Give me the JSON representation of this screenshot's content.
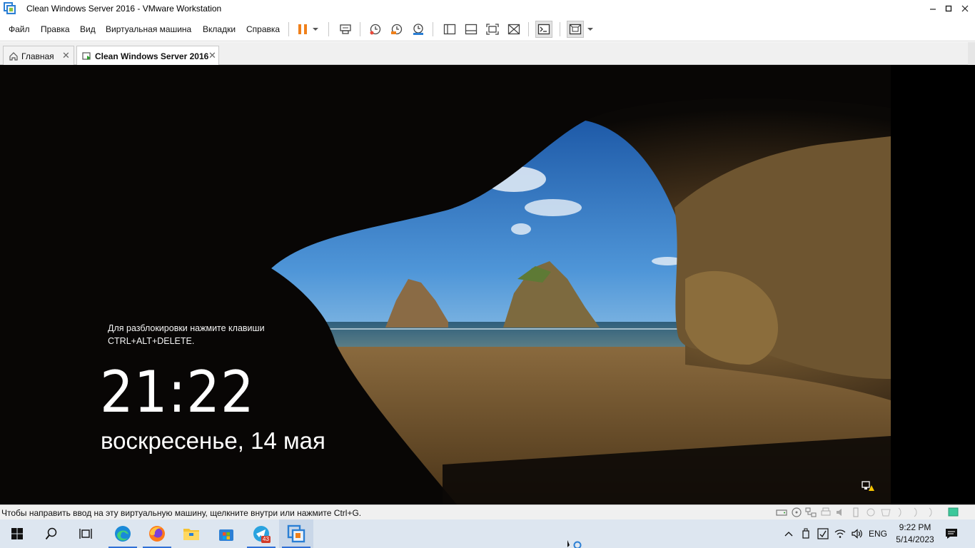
{
  "window": {
    "title": "Clean Windows Server 2016 - VMware Workstation",
    "minimize": "—",
    "maximize": "☐",
    "close": "✕"
  },
  "menu": {
    "items": [
      "Файл",
      "Правка",
      "Вид",
      "Виртуальная машина",
      "Вкладки",
      "Справка"
    ]
  },
  "toolbar": {
    "icons": [
      "pause-icon",
      "dropdown-arrow-icon",
      "send-ctrl-alt-del-icon",
      "snapshot-take-icon",
      "snapshot-revert-icon",
      "snapshot-manager-icon",
      "show-library-icon",
      "thumbnail-bar-icon",
      "full-screen-icon",
      "unity-icon",
      "console-view-icon",
      "stretch-guest-icon",
      "dropdown-arrow-icon"
    ]
  },
  "tabs": [
    {
      "label": "Главная",
      "active": false
    },
    {
      "label": "Clean Windows Server 2016",
      "active": true
    }
  ],
  "lockscreen": {
    "unlock_line1": "Для разблокировки нажмите клавиши",
    "unlock_line2": "CTRL+ALT+DELETE.",
    "time": "21:22",
    "date": "воскресенье, 14 мая"
  },
  "statusbar": {
    "text": "Чтобы направить ввод на эту виртуальную машину, щелкните внутри или нажмите Ctrl+G."
  },
  "taskbar": {
    "apps": [
      "start-icon",
      "search-icon",
      "task-view-icon",
      "edge-icon",
      "firefox-icon",
      "file-explorer-icon",
      "microsoft-store-icon",
      "telegram-icon",
      "vmware-icon"
    ],
    "telegram_badge": "43",
    "language": "ENG",
    "time": "9:22 PM",
    "date": "5/14/2023"
  },
  "colors": {
    "accent": "#2f6fd6",
    "pause": "#f0801a",
    "taskbar": "#dde6f0"
  }
}
